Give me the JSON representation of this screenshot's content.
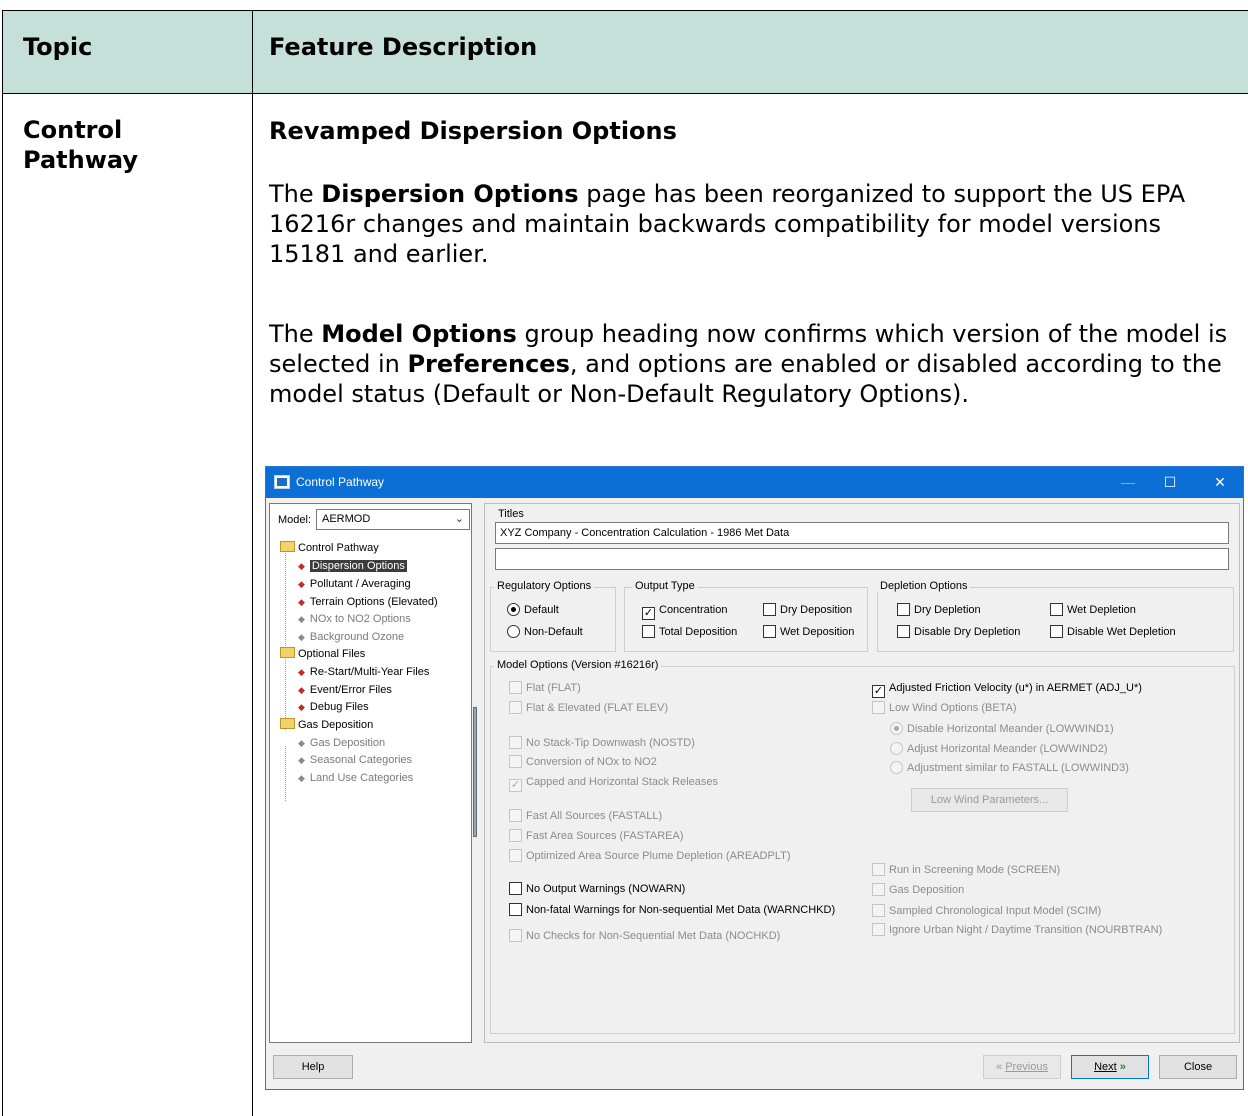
{
  "table": {
    "header_topic": "Topic",
    "header_feature": "Feature Description",
    "topic": "Control Pathway",
    "section_title": "Revamped Dispersion Options",
    "para1": {
      "pre": "The ",
      "bold1": "Dispersion Options",
      "post": " page has been reorganized to support the US EPA 16216r changes and maintain backwards compatibility for model versions 15181 and earlier."
    },
    "para2": {
      "pre": "The ",
      "bold1": "Model Options",
      "mid": " group heading now confirms which version of the model is selected in ",
      "bold2": "Preferences",
      "post": ", and options are enabled or disabled according to the model status (Default or Non-Default Regulatory Options)."
    }
  },
  "dialog": {
    "title": "Control Pathway",
    "window_buttons": {
      "minimize": "—",
      "maximize": "☐",
      "close": "✕"
    },
    "model_label": "Model:",
    "model_value": "AERMOD",
    "tree": [
      {
        "label": "Control Pathway",
        "kind": "folder"
      },
      {
        "label": "Dispersion Options",
        "kind": "item",
        "selected": true
      },
      {
        "label": "Pollutant / Averaging",
        "kind": "item"
      },
      {
        "label": "Terrain Options (Elevated)",
        "kind": "item"
      },
      {
        "label": "NOx to NO2 Options",
        "kind": "item",
        "disabled": true
      },
      {
        "label": "Background Ozone",
        "kind": "item",
        "disabled": true
      },
      {
        "label": "Optional Files",
        "kind": "folder"
      },
      {
        "label": "Re-Start/Multi-Year Files",
        "kind": "item"
      },
      {
        "label": "Event/Error Files",
        "kind": "item"
      },
      {
        "label": "Debug Files",
        "kind": "item"
      },
      {
        "label": "Gas Deposition",
        "kind": "folder"
      },
      {
        "label": "Gas Deposition",
        "kind": "item",
        "disabled": true
      },
      {
        "label": "Seasonal Categories",
        "kind": "item",
        "disabled": true
      },
      {
        "label": "Land Use Categories",
        "kind": "item",
        "disabled": true
      }
    ],
    "titles": {
      "label": "Titles",
      "line1": "XYZ Company - Concentration Calculation - 1986 Met Data",
      "line2": ""
    },
    "regulatory": {
      "label": "Regulatory Options",
      "default": "Default",
      "non_default": "Non-Default"
    },
    "output": {
      "label": "Output Type",
      "concentration": "Concentration",
      "total_deposition": "Total Deposition",
      "dry_deposition": "Dry Deposition",
      "wet_deposition": "Wet Deposition"
    },
    "depletion": {
      "label": "Depletion Options",
      "dry": "Dry Depletion",
      "disable_dry": "Disable Dry Depletion",
      "wet": "Wet Depletion",
      "disable_wet": "Disable Wet Depletion"
    },
    "model_options": {
      "label": "Model Options (Version #16216r)",
      "flat": "Flat (FLAT)",
      "flat_elev": "Flat & Elevated  (FLAT ELEV)",
      "nostd": "No Stack-Tip Downwash (NOSTD)",
      "nox": "Conversion of NOx to NO2",
      "capped": "Capped and Horizontal Stack Releases",
      "fastall": "Fast All Sources (FASTALL)",
      "fastarea": "Fast Area Sources (FASTAREA)",
      "areadplt": "Optimized Area Source Plume Depletion (AREADPLT)",
      "nowarn": "No Output Warnings (NOWARN)",
      "warnchkd": "Non-fatal Warnings for Non-sequential Met Data (WARNCHKD)",
      "nochkd": "No Checks for Non-Sequential Met Data (NOCHKD)",
      "adj_u": "Adjusted Friction Velocity (u*) in AERMET (ADJ_U*)",
      "lowwind": "Low Wind Options (BETA)",
      "lowwind1": "Disable Horizontal Meander (LOWWIND1)",
      "lowwind2": "Adjust Horizontal Meander (LOWWIND2)",
      "lowwind3": "Adjustment similar to FASTALL (LOWWIND3)",
      "lowwind_params": "Low Wind Parameters...",
      "screen": "Run in Screening Mode (SCREEN)",
      "gas_dep": "Gas Deposition",
      "scim": "Sampled Chronological Input Model (SCIM)",
      "nourbtran": "Ignore Urban Night / Daytime Transition (NOURBTRAN)"
    },
    "buttons": {
      "help": "Help",
      "previous": "Previous",
      "next": "Next",
      "close": "Close"
    },
    "colors": {
      "titlebar": "#0c6fd6",
      "header_row": "#c5e0d9",
      "red_diamond": "#c62828"
    }
  }
}
